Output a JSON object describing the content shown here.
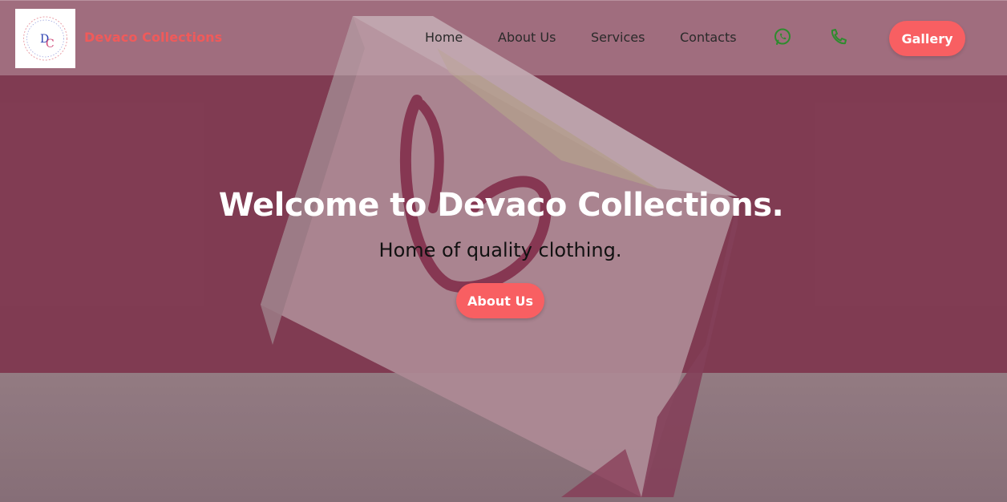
{
  "header": {
    "brand": "Devaco Collections",
    "logo_text": "DC",
    "nav": {
      "home": "Home",
      "about": "About Us",
      "services": "Services",
      "contacts": "Contacts"
    },
    "icons": {
      "whatsapp": "whatsapp-icon",
      "phone": "phone-icon"
    },
    "gallery_label": "Gallery"
  },
  "hero": {
    "title": "Welcome to Devaco Collections.",
    "subtitle": "Home of quality clothing.",
    "button_label": "About Us"
  },
  "colors": {
    "accent": "#f85f62",
    "brand_text": "#f05a5a",
    "icon_green": "#2e8b2e"
  }
}
